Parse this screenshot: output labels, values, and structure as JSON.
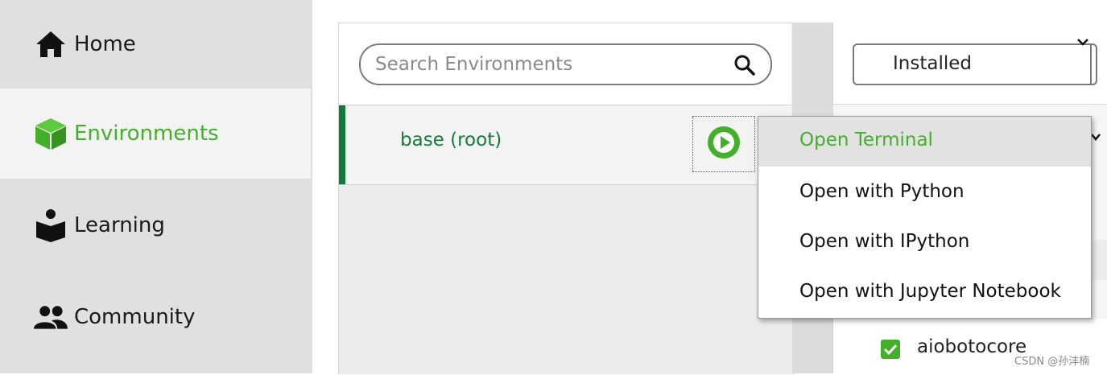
{
  "sidebar": {
    "items": [
      {
        "label": "Home",
        "icon": "home-icon"
      },
      {
        "label": "Environments",
        "icon": "cube-icon",
        "active": true
      },
      {
        "label": "Learning",
        "icon": "reader-icon"
      },
      {
        "label": "Community",
        "icon": "people-icon"
      }
    ]
  },
  "environments": {
    "search": {
      "placeholder": "Search Environments",
      "value": ""
    },
    "list": [
      {
        "name": "base (root)",
        "selected": true
      }
    ]
  },
  "context_menu": {
    "items": [
      {
        "label": "Open Terminal",
        "highlighted": true
      },
      {
        "label": "Open with Python"
      },
      {
        "label": "Open with IPython"
      },
      {
        "label": "Open with Jupyter Notebook"
      }
    ]
  },
  "packages": {
    "filter": {
      "selected": "Installed"
    },
    "rows": [
      {
        "name": "aiobotocore",
        "checked": true
      }
    ]
  },
  "watermark": "CSDN @孙沣楠",
  "colors": {
    "accent": "#43b02a",
    "active_bar": "#0f7a3c",
    "env_text": "#137c3d"
  }
}
